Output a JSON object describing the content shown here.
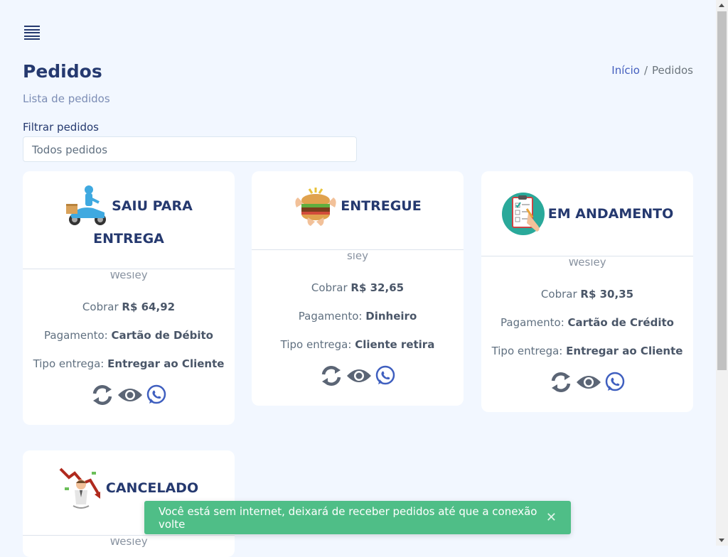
{
  "page": {
    "title": "Pedidos",
    "subtitle": "Lista de pedidos"
  },
  "breadcrumb": {
    "home": "Início",
    "separator": "/",
    "current": "Pedidos"
  },
  "filter": {
    "label": "Filtrar pedidos",
    "selected": "Todos pedidos"
  },
  "orders": [
    {
      "status_line1": "SAIU PARA",
      "status_line2": "ENTREGA",
      "customer_partial": "Wesley",
      "charge_label": "Cobrar",
      "charge_value": "R$ 64,92",
      "payment_label": "Pagamento:",
      "payment_value": "Cartão de Débito",
      "delivery_label": "Tipo entrega:",
      "delivery_value": "Entregar ao Cliente",
      "illustration": "delivery-scooter"
    },
    {
      "status": "ENTREGUE",
      "customer_partial": "sley",
      "charge_label": "Cobrar",
      "charge_value": "R$ 32,65",
      "payment_label": "Pagamento:",
      "payment_value": "Dinheiro",
      "delivery_label": "Tipo entrega:",
      "delivery_value": "Cliente retira",
      "illustration": "burger-hands"
    },
    {
      "status": "EM ANDAMENTO",
      "customer_partial": "Wesley",
      "charge_label": "Cobrar",
      "charge_value": "R$ 30,35",
      "payment_label": "Pagamento:",
      "payment_value": "Cartão de Crédito",
      "delivery_label": "Tipo entrega:",
      "delivery_value": "Entregar ao Cliente",
      "illustration": "checklist"
    },
    {
      "status": "CANCELADO",
      "customer_partial": "Wesley",
      "illustration": "falling-chart-man"
    }
  ],
  "icons": {
    "refresh": "refresh-icon",
    "view": "eye-icon",
    "whatsapp": "whatsapp-icon",
    "menu": "hamburger-icon",
    "close": "close-icon"
  },
  "toast": {
    "message": "Você está sem internet, deixará de receber pedidos até que a conexão volte",
    "close": "✕"
  },
  "colors": {
    "background": "#f2f7ff",
    "primary_text": "#25396f",
    "link": "#435ebe",
    "toast": "#4fbe87",
    "icon_gray": "#5b6575",
    "whatsapp_blue": "#3f5fbf"
  }
}
